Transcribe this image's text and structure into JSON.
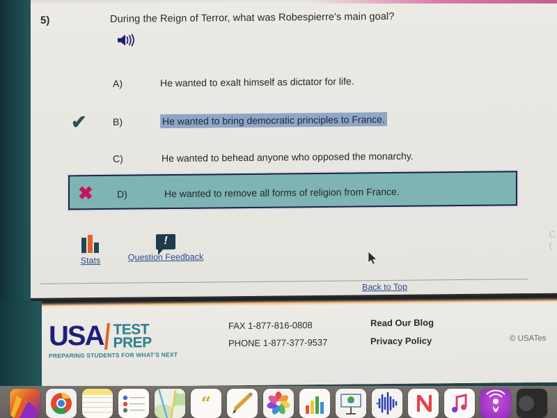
{
  "question": {
    "number": "5)",
    "text": "During the Reign of Terror, what was Robespierre's main goal?",
    "audio_icon": "speaker-icon"
  },
  "options": [
    {
      "letter": "A)",
      "text": "He wanted to exalt himself as dictator for life.",
      "mark": "",
      "state": "normal"
    },
    {
      "letter": "B)",
      "text": "He wanted to bring democratic principles to France.",
      "mark": "✔",
      "state": "correct-highlighted"
    },
    {
      "letter": "C)",
      "text": "He wanted to behead anyone who opposed the monarchy.",
      "mark": "",
      "state": "normal"
    },
    {
      "letter": "D)",
      "text": "He wanted to remove all forms of religion from France.",
      "mark": "✖",
      "state": "selected-incorrect"
    }
  ],
  "tools": {
    "stats_label": "Stats",
    "stats_icon": "bar-chart-icon",
    "feedback_label": "Question Feedback",
    "feedback_icon": "speech-bubble-exclamation-icon",
    "back_to_top": "Back to Top"
  },
  "footer": {
    "logo_usa": "USA",
    "logo_test": "TEST",
    "logo_prep": "PREP",
    "tagline": "PREPARING STUDENTS FOR WHAT'S NEXT",
    "fax": "FAX 1-877-816-0808",
    "phone": "PHONE 1-877-377-9537",
    "blog": "Read Our Blog",
    "privacy": "Privacy Policy",
    "copyright": "© USATes"
  },
  "colors": {
    "teal_box": "#7fb4b4",
    "box_border": "#1b2348",
    "selection_blue": "#8fa7c6",
    "check_green": "#2e4f55",
    "x_red": "#c2185b",
    "link_blue": "#2a4d8f",
    "logo_navy": "#1f1f7a",
    "logo_teal": "#2e7f8c",
    "logo_orange": "#e2622a"
  },
  "dock": {
    "items": [
      {
        "name": "finder-icon",
        "label": "Finder"
      },
      {
        "name": "chrome-icon",
        "label": "Google Chrome"
      },
      {
        "name": "notes-icon",
        "label": "Notes"
      },
      {
        "name": "reminders-icon",
        "label": "Reminders"
      },
      {
        "name": "maps-icon",
        "label": "Maps"
      },
      {
        "name": "pages-icon",
        "label": "Pages"
      },
      {
        "name": "keynote-pencil-icon",
        "label": "Keynote"
      },
      {
        "name": "photos-icon",
        "label": "Photos"
      },
      {
        "name": "numbers-icon",
        "label": "Numbers"
      },
      {
        "name": "keynote-icon",
        "label": "Keynote"
      },
      {
        "name": "garageband-icon",
        "label": "GarageBand"
      },
      {
        "name": "news-icon",
        "label": "News"
      },
      {
        "name": "music-icon",
        "label": "Music"
      },
      {
        "name": "podcasts-icon",
        "label": "Podcasts"
      },
      {
        "name": "app-icon",
        "label": "App"
      }
    ]
  }
}
